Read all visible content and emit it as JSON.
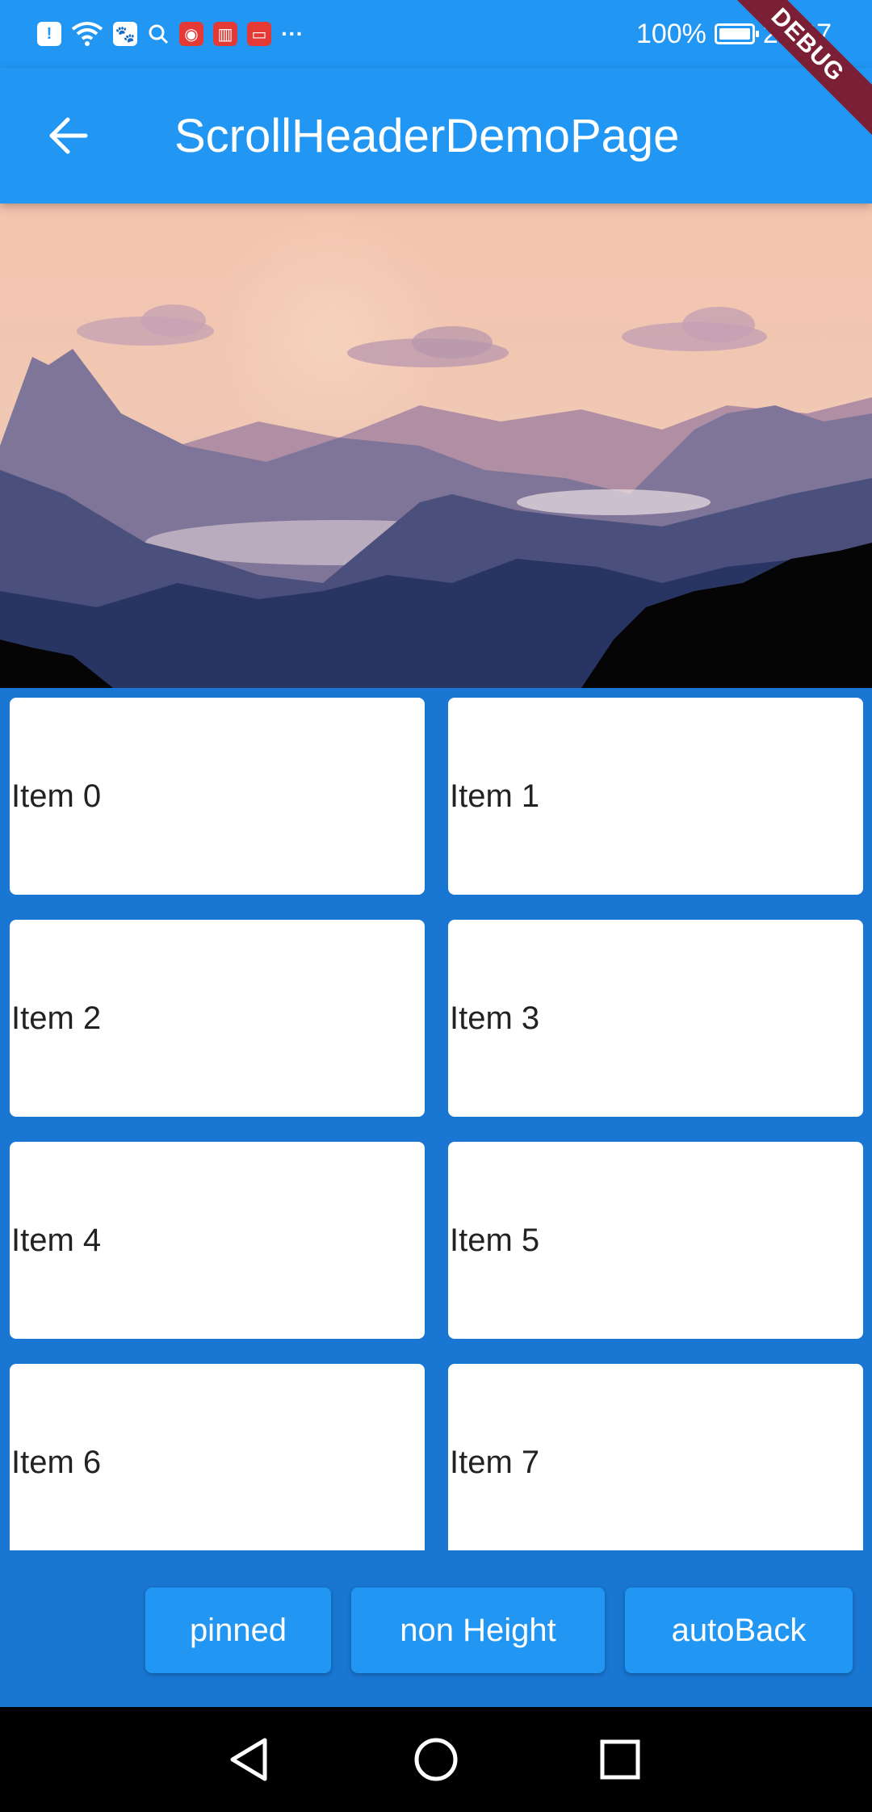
{
  "status_bar": {
    "left_icons": [
      "alert-icon",
      "wifi-icon",
      "baidu-icon",
      "search-icon",
      "weibo-icon",
      "ting-icon",
      "book-icon",
      "more-icon"
    ],
    "more_glyph": "···",
    "battery": "100%",
    "time": "20:07"
  },
  "debug_banner": "DEBUG",
  "app_bar": {
    "title": "ScrollHeaderDemoPage"
  },
  "grid": {
    "items": [
      "Item 0",
      "Item 1",
      "Item 2",
      "Item 3",
      "Item 4",
      "Item 5",
      "Item 6",
      "Item 7"
    ]
  },
  "bottom_buttons": {
    "pinned": "pinned",
    "non_height": "non Height",
    "auto_back": "autoBack"
  },
  "colors": {
    "primary": "#2196f3",
    "primary_dark": "#1976d2",
    "card": "#ffffff",
    "debug": "#7b1f35"
  }
}
